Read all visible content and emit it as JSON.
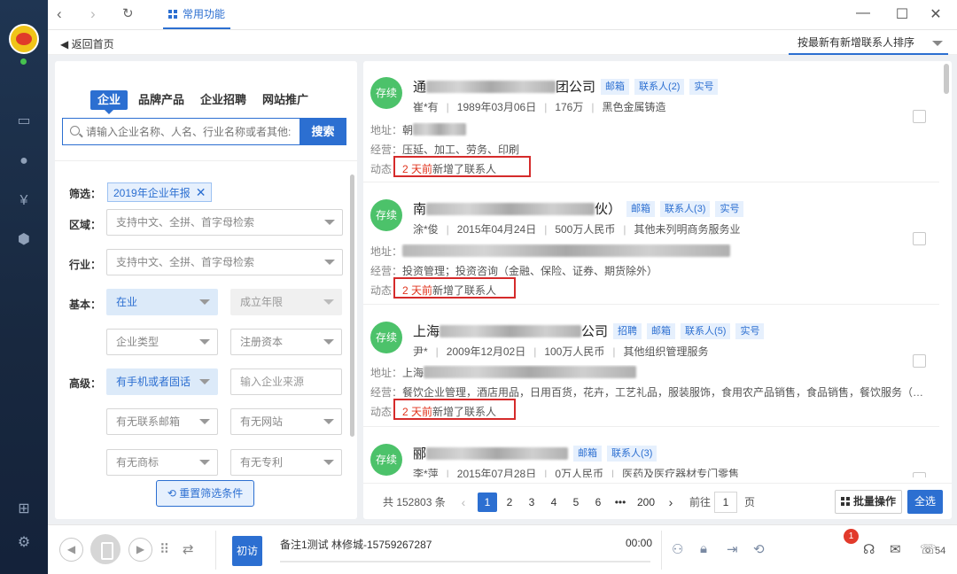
{
  "top": {
    "favorites_label": "常用功能",
    "back_home": "返回首页",
    "sort": "按最新有新增联系人排序"
  },
  "search": {
    "tabs": [
      "企业",
      "品牌产品",
      "企业招聘",
      "网站推广"
    ],
    "placeholder": "请输入企业名称、人名、行业名称或者其他:",
    "button": "搜索"
  },
  "filters": {
    "screen_label": "筛选：",
    "screen_tag": "2019年企业年报",
    "region_label": "区域：",
    "region_placeholder": "支持中文、全拼、首字母检索",
    "industry_label": "行业：",
    "industry_placeholder": "支持中文、全拼、首字母检索",
    "basic_label": "基本：",
    "status": "在业",
    "established": "成立年限",
    "company_type": "企业类型",
    "capital": "注册资本",
    "advanced_label": "高级：",
    "phone": "有手机或者固话",
    "source_placeholder": "输入企业来源",
    "email": "有无联系邮箱",
    "website": "有无网站",
    "trademark": "有无商标",
    "patent": "有无专利",
    "reset": "重置筛选条件"
  },
  "labels": {
    "address": "地址：",
    "business": "经营：",
    "dynamic": "动态：",
    "dyn_red": "2 天前",
    "dyn_rest": "新增了联系人",
    "badge": "存续"
  },
  "companies": [
    {
      "name_visible_start": "通",
      "name_visible_end": "团公司",
      "tags": [
        "邮箱",
        "联系人(2)",
        "实号"
      ],
      "person": "崔*有",
      "date": "1989年03月06日",
      "capital": "176万",
      "industry": "黑色金属铸造",
      "address_visible": "朝",
      "business": "压延、加工、劳务、印刷"
    },
    {
      "name_visible_start": "南",
      "name_visible_end": "伙）",
      "tags": [
        "邮箱",
        "联系人(3)",
        "实号"
      ],
      "person": "涂*俊",
      "date": "2015年04月24日",
      "capital": "500万人民币",
      "industry": "其他未列明商务服务业",
      "address_visible": "",
      "business": "投资管理；投资咨询（金融、保险、证券、期货除外）"
    },
    {
      "name_visible_start": "上海",
      "name_visible_end": "公司",
      "tags": [
        "招聘",
        "邮箱",
        "联系人(5)",
        "实号"
      ],
      "person": "尹*",
      "date": "2009年12月02日",
      "capital": "100万人民币",
      "industry": "其他组织管理服务",
      "address_visible": "上海",
      "business": "餐饮企业管理，酒店用品，日用百货，花卉，工艺礼品，服装服饰，食用农产品销售，食品销售，餐饮服务（仅限..."
    },
    {
      "name_visible_start": "郦",
      "name_visible_end": "",
      "tags": [
        "邮箱",
        "联系人(3)"
      ],
      "person": "李*萍",
      "date": "2015年07月28日",
      "capital": "0万人民币",
      "industry": "医药及医疗器材专门零售",
      "address_visible": "",
      "business": ""
    }
  ],
  "pager": {
    "total": "共 152803 条",
    "pages": [
      "1",
      "2",
      "3",
      "4",
      "5",
      "6",
      "•••",
      "200"
    ],
    "goto": "前往",
    "goto_value": "1",
    "page_unit": "页",
    "batch": "批量操作",
    "select_all": "全选"
  },
  "bottom": {
    "first_visit": "初访",
    "note": "备注1测试   林修城-15759267287",
    "time": "00:00",
    "notif_count": "1",
    "count": "54"
  }
}
